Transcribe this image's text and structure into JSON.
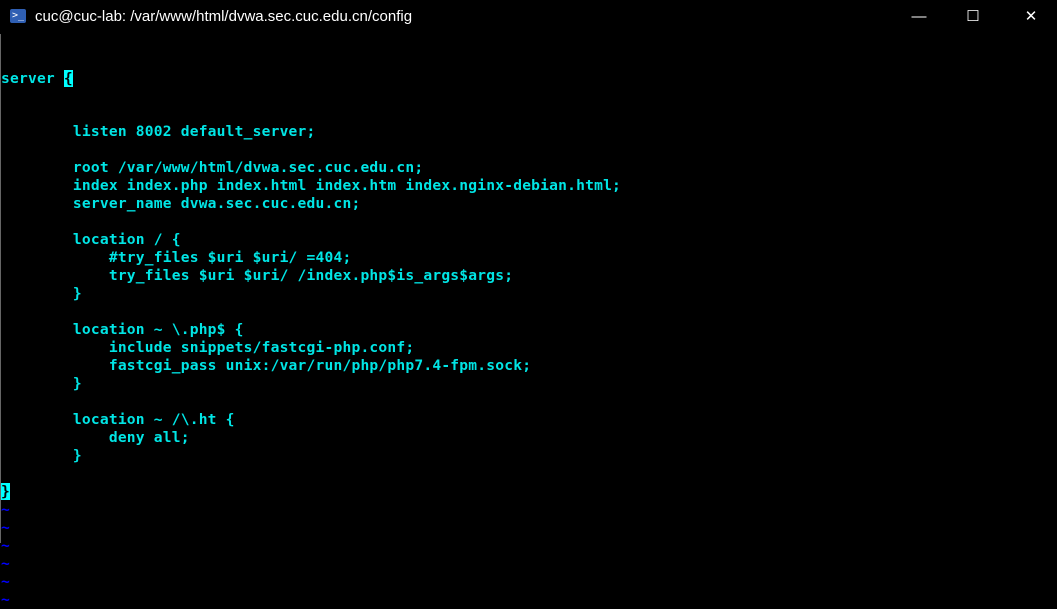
{
  "window": {
    "title": "cuc@cuc-lab: /var/www/html/dvwa.sec.cuc.edu.cn/config",
    "icon": "powershell-icon",
    "minimize": "—",
    "maximize": "☐",
    "close": "✕"
  },
  "editor": {
    "first_line": {
      "text": "server ",
      "cursor_char": "{"
    },
    "lines": [
      "",
      "        listen 8002 default_server;",
      "",
      "        root /var/www/html/dvwa.sec.cuc.edu.cn;",
      "        index index.php index.html index.htm index.nginx-debian.html;",
      "        server_name dvwa.sec.cuc.edu.cn;",
      "",
      "        location / {",
      "            #try_files $uri $uri/ =404;",
      "            try_files $uri $uri/ /index.php$is_args$args;",
      "        }",
      "",
      "        location ~ \\.php$ {",
      "            include snippets/fastcgi-php.conf;",
      "            fastcgi_pass unix:/var/run/php/php7.4-fpm.sock;",
      "        }",
      "",
      "        location ~ /\\.ht {",
      "            deny all;",
      "        }",
      ""
    ],
    "cursor_line_char": "}",
    "tildes": [
      "~",
      "~",
      "~",
      "~",
      "~",
      "~"
    ],
    "colors": {
      "text": "#00e5e5",
      "cursor": "#00ffff",
      "tilde": "#0000ff",
      "background": "#000000"
    }
  }
}
